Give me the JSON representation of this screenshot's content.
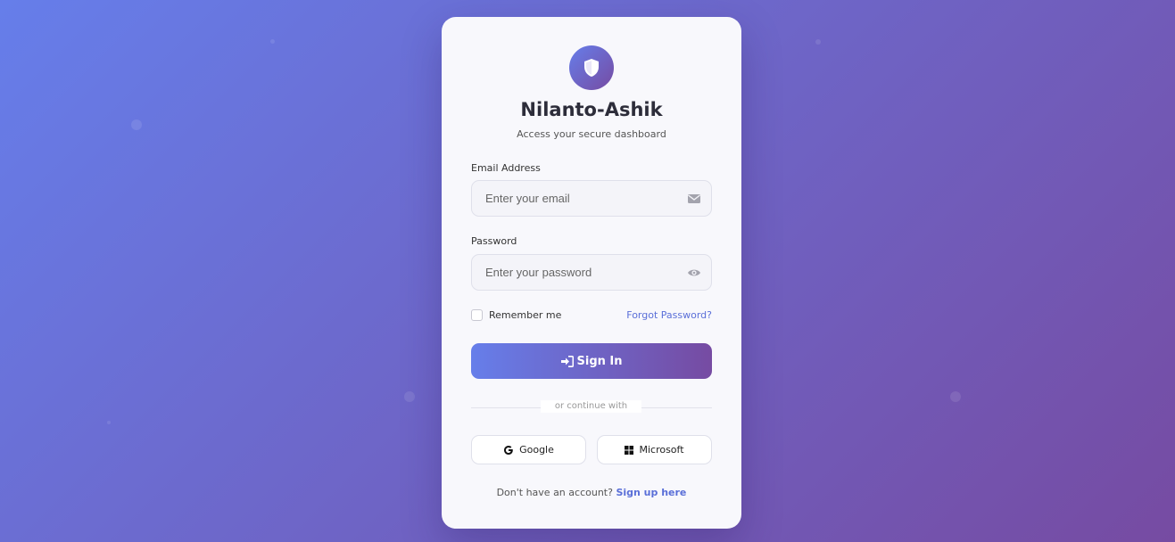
{
  "brand": {
    "title": "Nilanto-Ashik",
    "subtitle": "Access your secure dashboard",
    "logo_icon": "shield-icon",
    "accent_start": "#667eea",
    "accent_end": "#764ba2"
  },
  "email": {
    "label": "Email Address",
    "placeholder": "Enter your email",
    "value": "",
    "icon": "envelope-icon"
  },
  "password": {
    "label": "Password",
    "placeholder": "Enter your password",
    "value": "",
    "icon": "eye-icon"
  },
  "remember": {
    "label": "Remember me",
    "checked": false
  },
  "forgot": {
    "label": "Forgot Password?"
  },
  "signin": {
    "label": "Sign In",
    "icon": "sign-in-icon"
  },
  "divider": {
    "text": "or continue with"
  },
  "social": {
    "google": {
      "label": "Google",
      "icon": "google-icon"
    },
    "microsoft": {
      "label": "Microsoft",
      "icon": "windows-icon"
    }
  },
  "signup": {
    "prompt": "Don't have an account?",
    "link": "Sign up here"
  }
}
